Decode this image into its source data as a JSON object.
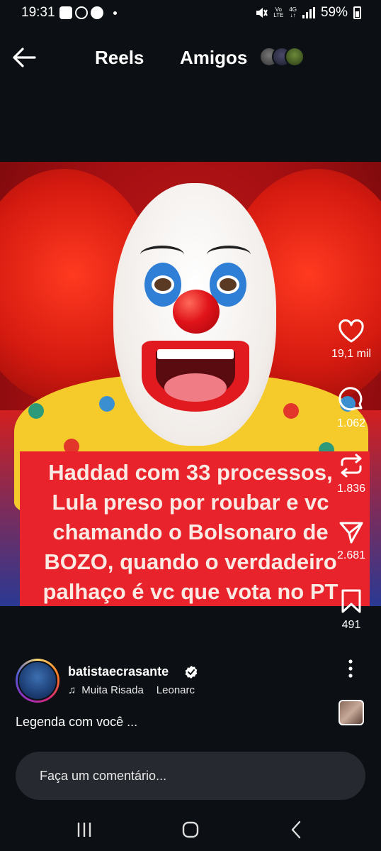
{
  "status_bar": {
    "time": "19:31",
    "network_top": "Vo",
    "network_bottom": "LTE",
    "data_top": "4G",
    "battery": "59%"
  },
  "header": {
    "tab_reels": "Reels",
    "tab_friends": "Amigos"
  },
  "video": {
    "caption_lines": [
      "Haddad com 33 processos,",
      "Lula preso por roubar e vc",
      "chamando o Bolsonaro de",
      "BOZO, quando o verdadeiro",
      "palhaço é vc que vota no PT"
    ]
  },
  "actions": {
    "likes": "19,1 mil",
    "comments": "1.062",
    "reposts": "1.836",
    "shares": "2.681",
    "saves": "491"
  },
  "author": {
    "username": "batistaecrasante",
    "music_title": "Muita Risada",
    "music_artist": "Leonarc"
  },
  "caption": "Legenda com você ...",
  "comment": {
    "placeholder": "Faça um comentário..."
  },
  "colors": {
    "background": "#0c1014",
    "caption_box": "#e8232b",
    "comment_box": "#262a30"
  }
}
